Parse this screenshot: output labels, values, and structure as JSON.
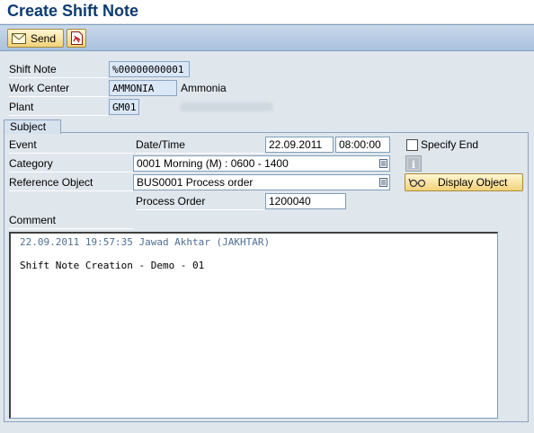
{
  "window": {
    "title": "Create Shift Note"
  },
  "toolbar": {
    "send_label": "Send",
    "pdf_icon": "pdf-document-icon"
  },
  "header_fields": {
    "shift_note": {
      "label": "Shift Note",
      "value": "%00000000001"
    },
    "work_center": {
      "label": "Work Center",
      "value": "AMMONIA",
      "description": "Ammonia"
    },
    "plant": {
      "label": "Plant",
      "value": "GM01"
    }
  },
  "subject": {
    "tab_label": "Subject",
    "event_label": "Event",
    "datetime_label": "Date/Time",
    "date": "22.09.2011",
    "time": "08:00:00",
    "specify_end_label": "Specify End",
    "specify_end_checked": false,
    "category_label": "Category",
    "category_value": "0001 Morning (M) : 0600 - 1400",
    "reference_object_label": "Reference Object",
    "reference_object_value": "BUS0001 Process order",
    "display_object_label": "Display Object",
    "process_order_label": "Process Order",
    "process_order_value": "1200040",
    "comment_label": "Comment",
    "comment_header": "22.09.2011 19:57:35 Jawad Akhtar (JAKHTAR)",
    "comment_text": "Shift Note Creation - Demo - 01"
  }
}
